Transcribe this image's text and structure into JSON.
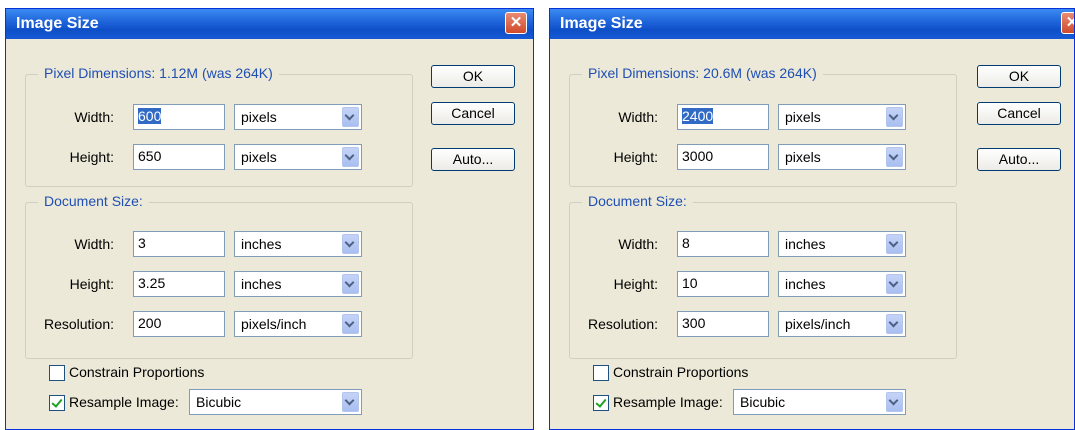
{
  "dialogs": [
    {
      "title": "Image Size",
      "close_glyph": "✕",
      "pixel_dimensions": {
        "legend": "Pixel Dimensions:  1.12M (was 264K)",
        "width_label": "Width:",
        "width_value": "600",
        "width_unit": "pixels",
        "height_label": "Height:",
        "height_value": "650",
        "height_unit": "pixels"
      },
      "document_size": {
        "legend": "Document Size:",
        "width_label": "Width:",
        "width_value": "3",
        "width_unit": "inches",
        "height_label": "Height:",
        "height_value": "3.25",
        "height_unit": "inches",
        "resolution_label": "Resolution:",
        "resolution_value": "200",
        "resolution_unit": "pixels/inch"
      },
      "buttons": {
        "ok": "OK",
        "cancel": "Cancel",
        "auto": "Auto..."
      },
      "constrain_label": "Constrain Proportions",
      "constrain_checked": false,
      "resample_label": "Resample Image:",
      "resample_checked": true,
      "resample_method": "Bicubic"
    },
    {
      "title": "Image Size",
      "close_glyph": "✕",
      "pixel_dimensions": {
        "legend": "Pixel Dimensions:  20.6M (was 264K)",
        "width_label": "Width:",
        "width_value": "2400",
        "width_unit": "pixels",
        "height_label": "Height:",
        "height_value": "3000",
        "height_unit": "pixels"
      },
      "document_size": {
        "legend": "Document Size:",
        "width_label": "Width:",
        "width_value": "8",
        "width_unit": "inches",
        "height_label": "Height:",
        "height_value": "10",
        "height_unit": "inches",
        "resolution_label": "Resolution:",
        "resolution_value": "300",
        "resolution_unit": "pixels/inch"
      },
      "buttons": {
        "ok": "OK",
        "cancel": "Cancel",
        "auto": "Auto..."
      },
      "constrain_label": "Constrain Proportions",
      "constrain_checked": false,
      "resample_label": "Resample Image:",
      "resample_checked": true,
      "resample_method": "Bicubic"
    }
  ],
  "colors": {
    "titlebar": "#0e4fc8",
    "dialog_bg": "#ece9d8",
    "legend_text": "#1f4fb3",
    "selection": "#316ac5"
  }
}
